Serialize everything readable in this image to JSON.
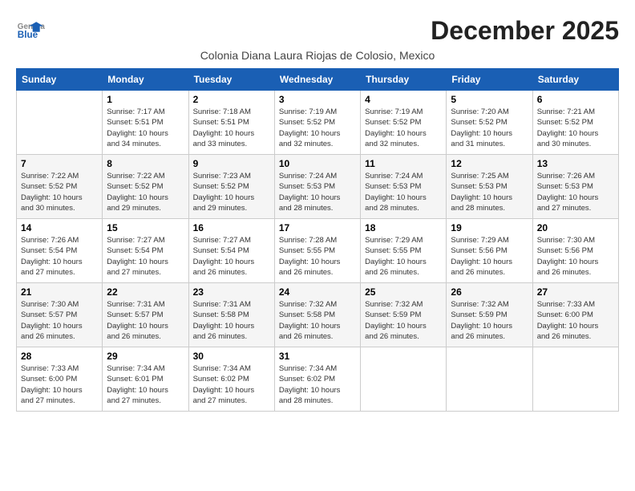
{
  "logo": {
    "general": "General",
    "blue": "Blue"
  },
  "title": "December 2025",
  "location": "Colonia Diana Laura Riojas de Colosio, Mexico",
  "days_header": [
    "Sunday",
    "Monday",
    "Tuesday",
    "Wednesday",
    "Thursday",
    "Friday",
    "Saturday"
  ],
  "weeks": [
    [
      {
        "num": "",
        "info": ""
      },
      {
        "num": "1",
        "info": "Sunrise: 7:17 AM\nSunset: 5:51 PM\nDaylight: 10 hours\nand 34 minutes."
      },
      {
        "num": "2",
        "info": "Sunrise: 7:18 AM\nSunset: 5:51 PM\nDaylight: 10 hours\nand 33 minutes."
      },
      {
        "num": "3",
        "info": "Sunrise: 7:19 AM\nSunset: 5:52 PM\nDaylight: 10 hours\nand 32 minutes."
      },
      {
        "num": "4",
        "info": "Sunrise: 7:19 AM\nSunset: 5:52 PM\nDaylight: 10 hours\nand 32 minutes."
      },
      {
        "num": "5",
        "info": "Sunrise: 7:20 AM\nSunset: 5:52 PM\nDaylight: 10 hours\nand 31 minutes."
      },
      {
        "num": "6",
        "info": "Sunrise: 7:21 AM\nSunset: 5:52 PM\nDaylight: 10 hours\nand 30 minutes."
      }
    ],
    [
      {
        "num": "7",
        "info": "Sunrise: 7:22 AM\nSunset: 5:52 PM\nDaylight: 10 hours\nand 30 minutes."
      },
      {
        "num": "8",
        "info": "Sunrise: 7:22 AM\nSunset: 5:52 PM\nDaylight: 10 hours\nand 29 minutes."
      },
      {
        "num": "9",
        "info": "Sunrise: 7:23 AM\nSunset: 5:52 PM\nDaylight: 10 hours\nand 29 minutes."
      },
      {
        "num": "10",
        "info": "Sunrise: 7:24 AM\nSunset: 5:53 PM\nDaylight: 10 hours\nand 28 minutes."
      },
      {
        "num": "11",
        "info": "Sunrise: 7:24 AM\nSunset: 5:53 PM\nDaylight: 10 hours\nand 28 minutes."
      },
      {
        "num": "12",
        "info": "Sunrise: 7:25 AM\nSunset: 5:53 PM\nDaylight: 10 hours\nand 28 minutes."
      },
      {
        "num": "13",
        "info": "Sunrise: 7:26 AM\nSunset: 5:53 PM\nDaylight: 10 hours\nand 27 minutes."
      }
    ],
    [
      {
        "num": "14",
        "info": "Sunrise: 7:26 AM\nSunset: 5:54 PM\nDaylight: 10 hours\nand 27 minutes."
      },
      {
        "num": "15",
        "info": "Sunrise: 7:27 AM\nSunset: 5:54 PM\nDaylight: 10 hours\nand 27 minutes."
      },
      {
        "num": "16",
        "info": "Sunrise: 7:27 AM\nSunset: 5:54 PM\nDaylight: 10 hours\nand 26 minutes."
      },
      {
        "num": "17",
        "info": "Sunrise: 7:28 AM\nSunset: 5:55 PM\nDaylight: 10 hours\nand 26 minutes."
      },
      {
        "num": "18",
        "info": "Sunrise: 7:29 AM\nSunset: 5:55 PM\nDaylight: 10 hours\nand 26 minutes."
      },
      {
        "num": "19",
        "info": "Sunrise: 7:29 AM\nSunset: 5:56 PM\nDaylight: 10 hours\nand 26 minutes."
      },
      {
        "num": "20",
        "info": "Sunrise: 7:30 AM\nSunset: 5:56 PM\nDaylight: 10 hours\nand 26 minutes."
      }
    ],
    [
      {
        "num": "21",
        "info": "Sunrise: 7:30 AM\nSunset: 5:57 PM\nDaylight: 10 hours\nand 26 minutes."
      },
      {
        "num": "22",
        "info": "Sunrise: 7:31 AM\nSunset: 5:57 PM\nDaylight: 10 hours\nand 26 minutes."
      },
      {
        "num": "23",
        "info": "Sunrise: 7:31 AM\nSunset: 5:58 PM\nDaylight: 10 hours\nand 26 minutes."
      },
      {
        "num": "24",
        "info": "Sunrise: 7:32 AM\nSunset: 5:58 PM\nDaylight: 10 hours\nand 26 minutes."
      },
      {
        "num": "25",
        "info": "Sunrise: 7:32 AM\nSunset: 5:59 PM\nDaylight: 10 hours\nand 26 minutes."
      },
      {
        "num": "26",
        "info": "Sunrise: 7:32 AM\nSunset: 5:59 PM\nDaylight: 10 hours\nand 26 minutes."
      },
      {
        "num": "27",
        "info": "Sunrise: 7:33 AM\nSunset: 6:00 PM\nDaylight: 10 hours\nand 26 minutes."
      }
    ],
    [
      {
        "num": "28",
        "info": "Sunrise: 7:33 AM\nSunset: 6:00 PM\nDaylight: 10 hours\nand 27 minutes."
      },
      {
        "num": "29",
        "info": "Sunrise: 7:34 AM\nSunset: 6:01 PM\nDaylight: 10 hours\nand 27 minutes."
      },
      {
        "num": "30",
        "info": "Sunrise: 7:34 AM\nSunset: 6:02 PM\nDaylight: 10 hours\nand 27 minutes."
      },
      {
        "num": "31",
        "info": "Sunrise: 7:34 AM\nSunset: 6:02 PM\nDaylight: 10 hours\nand 28 minutes."
      },
      {
        "num": "",
        "info": ""
      },
      {
        "num": "",
        "info": ""
      },
      {
        "num": "",
        "info": ""
      }
    ]
  ]
}
